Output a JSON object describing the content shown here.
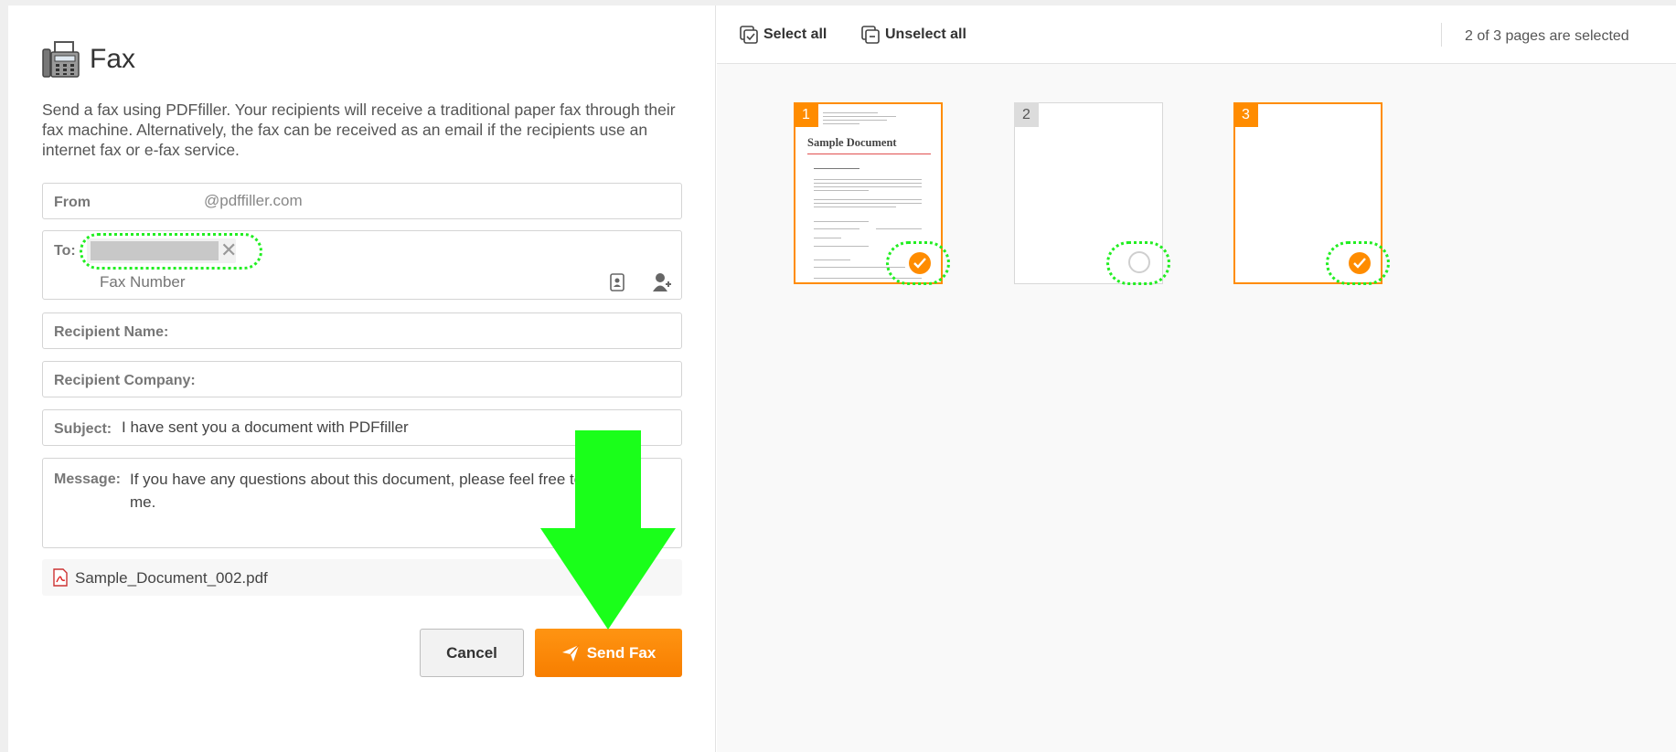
{
  "left": {
    "title": "Fax",
    "description": "Send a fax using PDFfiller. Your recipients will receive a traditional paper fax through their fax machine. Alternatively, the fax can be received as an email if the recipients use an internet fax or e-fax service.",
    "from": {
      "label": "From",
      "value": "@pdffiller.com"
    },
    "to": {
      "label": "To:",
      "placeholder": "Fax Number"
    },
    "recipient_name": {
      "label": "Recipient Name:",
      "value": ""
    },
    "recipient_company": {
      "label": "Recipient Company:",
      "value": ""
    },
    "subject": {
      "label": "Subject:",
      "value": "I have sent you a document with PDFfiller"
    },
    "message": {
      "label": "Message:",
      "value": "If you have any questions about this document, please feel free to contact me."
    },
    "attachment": {
      "name": "Sample_Document_002.pdf"
    },
    "cancel_label": "Cancel",
    "send_label": "Send Fax"
  },
  "right": {
    "select_all_label": "Select all",
    "unselect_all_label": "Unselect all",
    "status": "2 of 3 pages are selected",
    "pages": [
      {
        "number": "1",
        "selected": true,
        "title": "Sample Document"
      },
      {
        "number": "2",
        "selected": false
      },
      {
        "number": "3",
        "selected": true
      }
    ]
  },
  "colors": {
    "accent": "#ff8c00",
    "highlight": "#22ee22"
  }
}
